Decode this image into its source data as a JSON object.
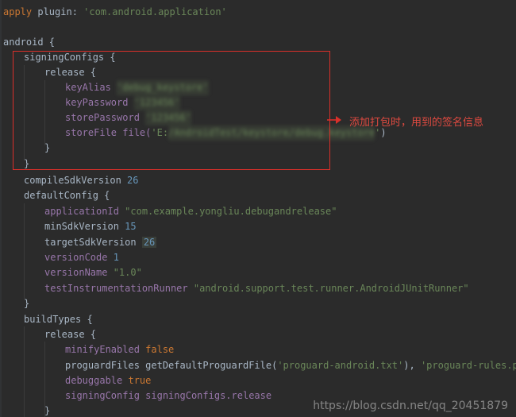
{
  "editor": {
    "lines": {
      "apply": {
        "kw": "apply",
        "mid": " plugin: ",
        "str": "'com.android.application'"
      },
      "android": "android {",
      "signingConfigs": "signingConfigs {",
      "release_open": "release {",
      "keyAlias": {
        "key": "keyAlias ",
        "val": "'debug_keystore'"
      },
      "keyPassword": {
        "key": "keyPassword ",
        "val": "'123456'"
      },
      "storePassword": {
        "key": "storePassword ",
        "val": "'123456'"
      },
      "storeFile": {
        "key": "storeFile file(",
        "str_start": "'E:",
        "blurred": "/AndroidTest/keystore/debug.keystore",
        "str_end": "'",
        "close": ")"
      },
      "close_inner": "}",
      "close_signing": "}",
      "compileSdk": {
        "key": "compileSdkVersion ",
        "num": "26"
      },
      "defaultConfig": "defaultConfig {",
      "applicationId": {
        "key": "applicationId ",
        "str": "\"com.example.yongliu.debugandrelease\""
      },
      "minSdk": {
        "key": "minSdkVersion ",
        "num": "15"
      },
      "targetSdk": {
        "key": "targetSdkVersion ",
        "num": "26"
      },
      "versionCode": {
        "key": "versionCode ",
        "num": "1"
      },
      "versionName": {
        "key": "versionName ",
        "str": "\"1.0\""
      },
      "testRunner": {
        "key": "testInstrumentationRunner ",
        "str": "\"android.support.test.runner.AndroidJUnitRunner\""
      },
      "close_default": "}",
      "buildTypes": "buildTypes {",
      "release_bt": "release {",
      "minify": {
        "key": "minifyEnabled ",
        "kw": "false"
      },
      "proguard": {
        "key": "proguardFiles getDefaultProguardFile(",
        "str1": "'proguard-android.txt'",
        "mid": "), ",
        "str2": "'proguard-rules.pro'"
      },
      "debuggable": {
        "key": "debuggable ",
        "kw": "true"
      },
      "signingConfig": {
        "key": "signingConfig ",
        "ident": "signingConfigs.release"
      },
      "close_release": "}"
    }
  },
  "annotation": {
    "text": "添加打包时，用到的签名信息",
    "color": "#d9302a"
  },
  "watermark": {
    "text": "https://blog.csdn.net/qq_20451879"
  }
}
